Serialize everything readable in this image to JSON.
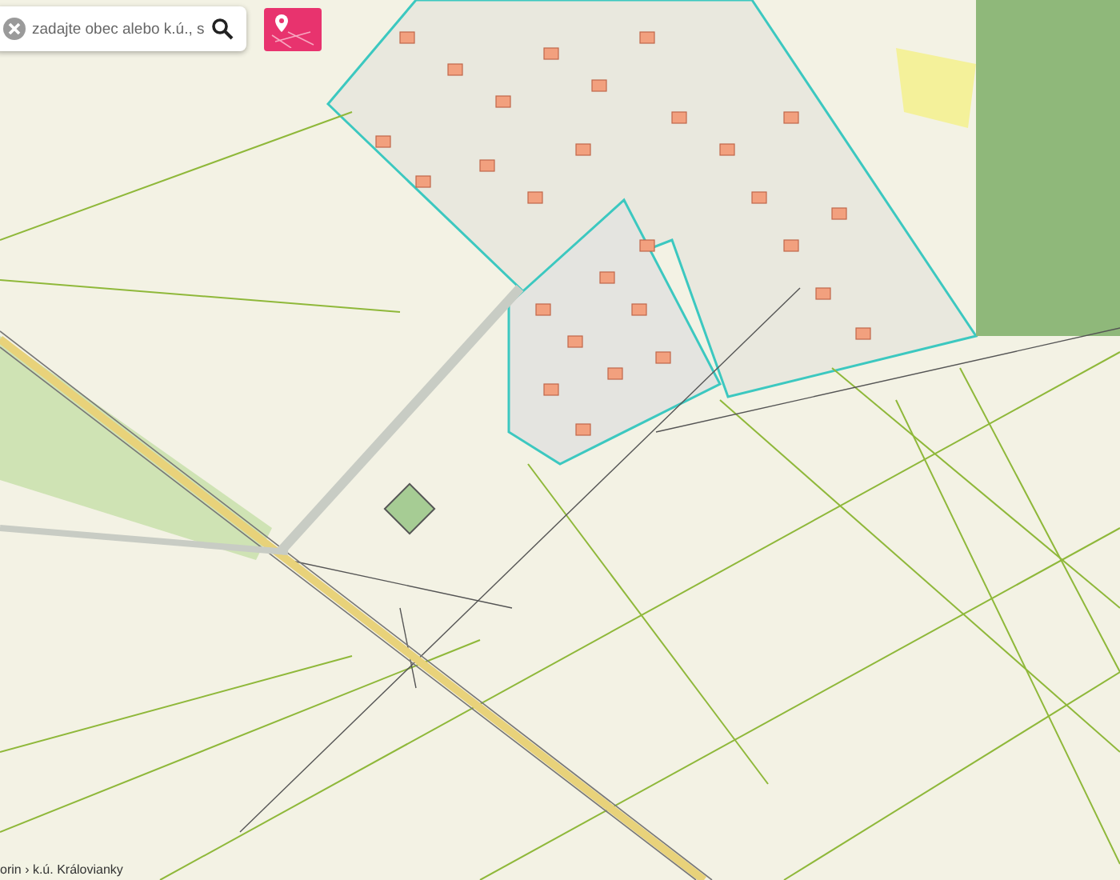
{
  "search": {
    "placeholder": "zadajte obec alebo k.ú., s"
  },
  "breadcrumb": "orin › k.ú. Královianky"
}
